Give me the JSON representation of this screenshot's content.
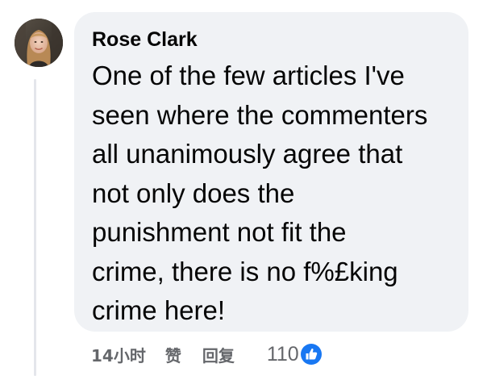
{
  "comment": {
    "author": "Rose Clark",
    "text": "One of the few articles I've\nseen where the commenters\nall unanimously agree that\nnot only does the\npunishment not fit the\ncrime, there is no f%£king\ncrime here!"
  },
  "actions": {
    "timestamp": "14小时",
    "like_label": "赞",
    "reply_label": "回复",
    "reaction_count": "110",
    "reaction_icon": "thumbs-up-icon"
  },
  "colors": {
    "bubble_bg": "#f0f2f5",
    "text": "#050505",
    "meta": "#65676b",
    "like_blue": "#1877f2"
  }
}
